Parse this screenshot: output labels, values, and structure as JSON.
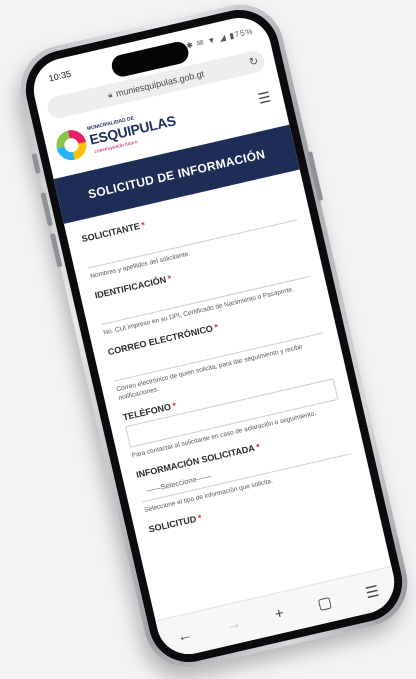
{
  "status": {
    "time": "10:35",
    "icons": "✱ ✉ ▼ ◢ ▮75%"
  },
  "browser": {
    "url": "muniesquipulas.gob.gt"
  },
  "logo": {
    "small_text": "MUNICIPALIDAD DE",
    "main_text": "ESQUIPULAS",
    "tagline": "construyendo futuro"
  },
  "banner": {
    "title": "SOLICITUD DE INFORMACIÓN"
  },
  "form": {
    "fields": [
      {
        "label": "SOLICITANTE",
        "help": "Nombres y apellidos del solicitante."
      },
      {
        "label": "IDENTIFICACIÓN",
        "help": "No. CUI impreso en su DPI, Certificado de Nacimiento o Pasaporte."
      },
      {
        "label": "CORREO ELECTRÓNICO",
        "help": "Correo electrónico de quien solicita, para dar seguimiento y recibir notificaciones."
      },
      {
        "label": "TELÉFONO",
        "help": "Para contactar al solicitante en caso de aclaración o seguimiento."
      },
      {
        "label": "INFORMACIÓN SOLICITADA",
        "select_value": "——Seleccione——",
        "help": "Seleccione el tipo de información que solicita."
      },
      {
        "label": "SOLICITUD"
      }
    ],
    "required_mark": "*"
  },
  "bottombar": {
    "back": "←",
    "forward": "→",
    "new_tab": "+",
    "tabs": "▢",
    "menu": "☰"
  }
}
